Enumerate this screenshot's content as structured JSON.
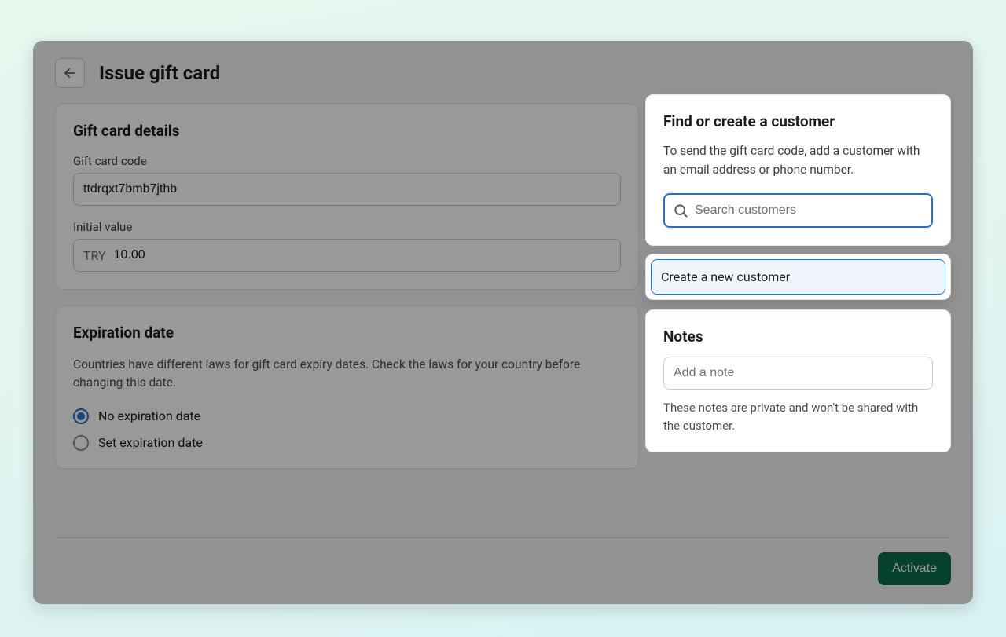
{
  "header": {
    "title": "Issue gift card"
  },
  "details": {
    "heading": "Gift card details",
    "code_label": "Gift card code",
    "code_value": "ttdrqxt7bmb7jthb",
    "initial_value_label": "Initial value",
    "currency_prefix": "TRY",
    "initial_value": "10.00"
  },
  "expiration": {
    "heading": "Expiration date",
    "help": "Countries have different laws for gift card expiry dates. Check the laws for your country before changing this date.",
    "options": {
      "none": "No expiration date",
      "set": "Set expiration date"
    },
    "selected": "none"
  },
  "customer": {
    "heading": "Find or create a customer",
    "help": "To send the gift card code, add a customer with an email address or phone number.",
    "search_placeholder": "Search customers",
    "create_label": "Create a new customer"
  },
  "notes": {
    "heading": "Notes",
    "placeholder": "Add a note",
    "help": "These notes are private and won't be shared with the customer."
  },
  "footer": {
    "activate": "Activate"
  }
}
